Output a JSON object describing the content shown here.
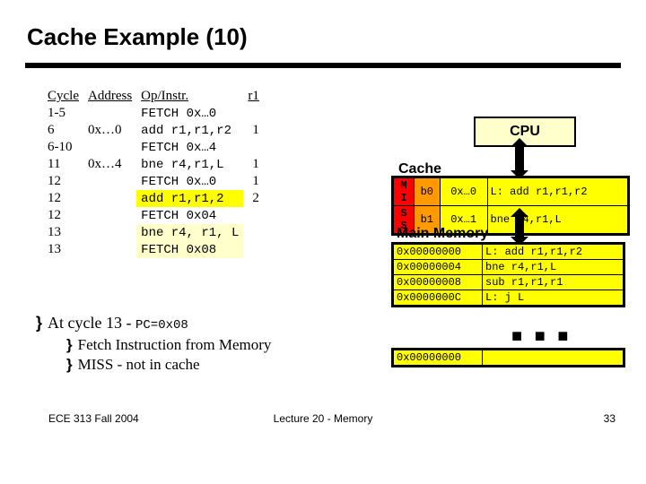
{
  "title": "Cache Example (10)",
  "trace_headers": {
    "cycle": "Cycle",
    "addr": "Address",
    "op": "Op/Instr.",
    "r1": "r1"
  },
  "trace_rows": [
    {
      "cycle": "1-5",
      "addr": "",
      "op": "FETCH 0x…0",
      "r1": "",
      "hl": ""
    },
    {
      "cycle": "6",
      "addr": "0x…0",
      "op": "add r1,r1,r2",
      "r1": "1",
      "hl": ""
    },
    {
      "cycle": "6-10",
      "addr": "",
      "op": "FETCH 0x…4",
      "r1": "",
      "hl": ""
    },
    {
      "cycle": "11",
      "addr": "0x…4",
      "op": "bne r4,r1,L",
      "r1": "1",
      "hl": ""
    },
    {
      "cycle": "12",
      "addr": "",
      "op": "FETCH 0x…0",
      "r1": "1",
      "hl": ""
    },
    {
      "cycle": "12",
      "addr": "",
      "op": "add r1,r1,2",
      "r1": "2",
      "hl": "hl-yellow"
    },
    {
      "cycle": "12",
      "addr": "",
      "op": "FETCH 0x04",
      "r1": "",
      "hl": ""
    },
    {
      "cycle": "13",
      "addr": "",
      "op": "bne r4, r1, L",
      "r1": "",
      "hl": "hl-cream"
    },
    {
      "cycle": "13",
      "addr": "",
      "op": "FETCH 0x08",
      "r1": "",
      "hl": "hl-cream"
    }
  ],
  "bullets": {
    "b1": "At cycle 13 - ",
    "b1_code": "PC=0x08",
    "b2a": "Fetch Instruction from Memory",
    "b2b": "MISS - not in cache"
  },
  "cpu_label": "CPU",
  "cache_label": "Cache",
  "cache_rows": [
    {
      "tag": "M",
      "b": "b0",
      "addr": "0x…0",
      "instr": "L: add r1,r1,r2"
    },
    {
      "tag": "I",
      "b": "",
      "addr": "",
      "instr": ""
    },
    {
      "tag": "S",
      "b": "b1",
      "addr": "0x…1",
      "instr": "bne r4,r1,L"
    },
    {
      "tag": "S",
      "b": "",
      "addr": "",
      "instr": ""
    }
  ],
  "mem_label": "Main Memory",
  "mem_rows": [
    {
      "addr": "0x00000000",
      "instr": "L: add r1,r1,r2"
    },
    {
      "addr": "0x00000004",
      "instr": "bne r4,r1,L"
    },
    {
      "addr": "0x00000008",
      "instr": "sub r1,r1,r1"
    },
    {
      "addr": "0x0000000C",
      "instr": "L: j L"
    }
  ],
  "mem_tail_addr": "0x00000000",
  "ellipsis": "■ ■ ■",
  "footer": {
    "left": "ECE 313 Fall 2004",
    "center": "Lecture 20 - Memory",
    "right": "33"
  }
}
